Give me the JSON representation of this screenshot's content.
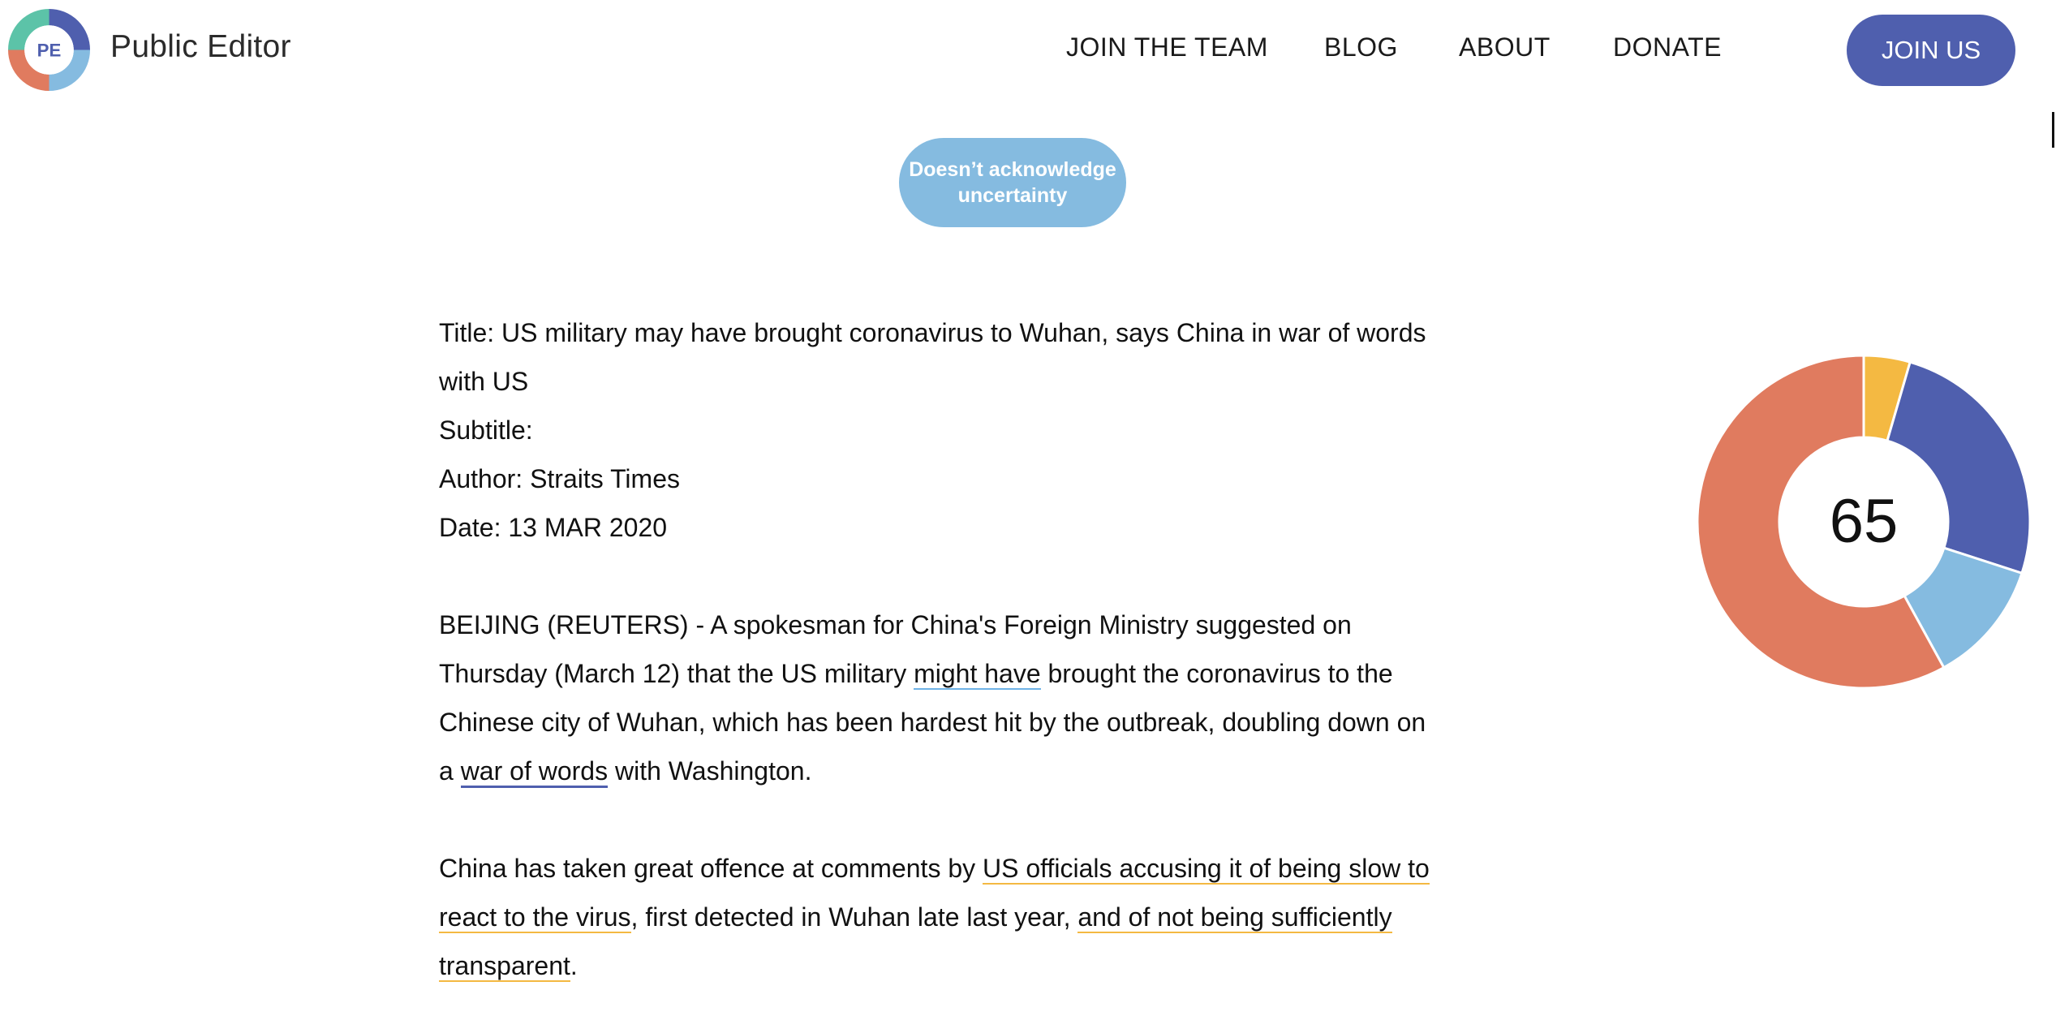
{
  "header": {
    "logo_text": "PE",
    "brand": "Public Editor",
    "nav": [
      "JOIN THE TEAM",
      "BLOG",
      "ABOUT",
      "DONATE"
    ],
    "join_button": "JOIN US"
  },
  "tag": {
    "line1": "Doesn’t acknowledge",
    "line2": "uncertainty",
    "color": "#85bbe0"
  },
  "article": {
    "title_label": "Title:",
    "title_value": "US military may have brought coronavirus to Wuhan, says China in war of words",
    "title_value_cont": "with US",
    "subtitle_label": "Subtitle:",
    "author_label": "Author:",
    "author_value": "Straits Times",
    "date_label": "Date:",
    "date_value": "13 MAR 2020",
    "p1": {
      "t1": "BEIJING (REUTERS) - A spokesman for China's Foreign Ministry suggested on Thursday (March 12) that the US military ",
      "h1": "might have",
      "t2": " brought the coronavirus to the Chinese city of Wuhan, which has been hardest hit by the outbreak, doubling down on a ",
      "h2": "war of words",
      "t3": " with Washington."
    },
    "p2": {
      "t1": "China has taken great offence at comments by ",
      "h1": "US officials accusing it of being slow to react to the virus",
      "t2": ", first detected in Wuhan late last year, ",
      "h2": "and of not being sufficiently transparent",
      "t3": "."
    }
  },
  "score": {
    "value": "65",
    "segments": [
      {
        "color": "#f4b942",
        "fraction": 0.045
      },
      {
        "color": "#4f5fae",
        "fraction": 0.255
      },
      {
        "color": "#85bbe0",
        "fraction": 0.12
      },
      {
        "color": "#e07b5f",
        "fraction": 0.58
      }
    ]
  },
  "colors": {
    "accent": "#4f5fae",
    "light_blue": "#85bbe0",
    "orange_underline": "#f4b942",
    "coral": "#e07b5f",
    "teal": "#5cc3a8"
  }
}
